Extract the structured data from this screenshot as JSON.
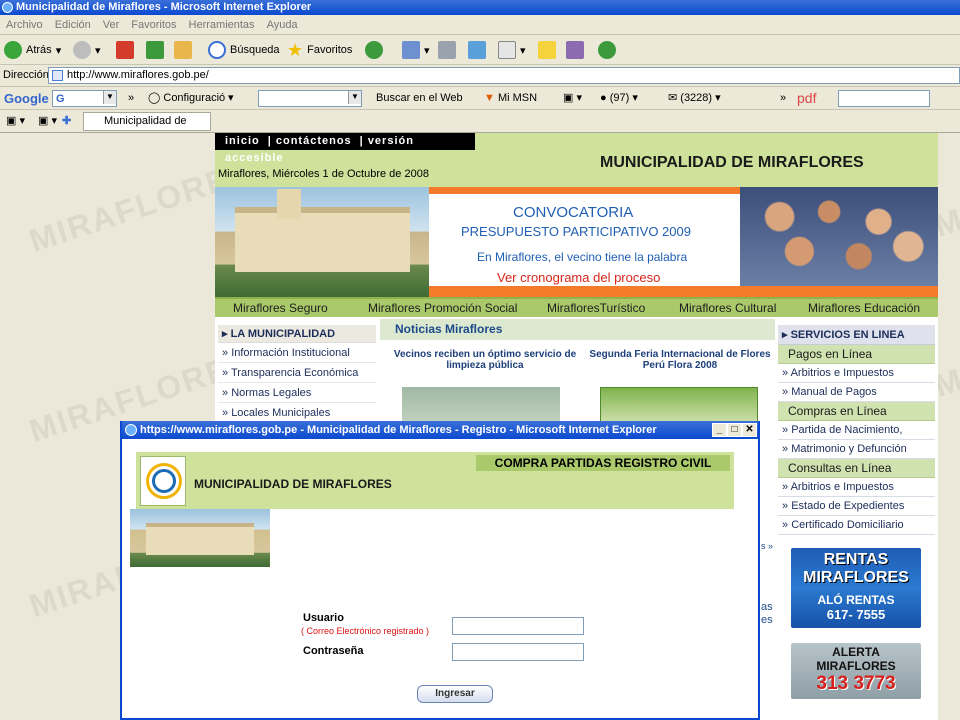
{
  "window": {
    "title": "Municipalidad de Miraflores - Microsoft Internet Explorer"
  },
  "menubar": {
    "items": [
      "Archivo",
      "Edición",
      "Ver",
      "Favoritos",
      "Herramientas",
      "Ayuda"
    ]
  },
  "toolbar": {
    "back_label": "Atrás",
    "search_label": "Búsqueda",
    "favorites_label": "Favoritos"
  },
  "address": {
    "label": "Dirección",
    "url": "http://www.miraflores.gob.pe/"
  },
  "googlebar": {
    "brand": "Google",
    "search_prefix": "G",
    "config_label": "Configuració",
    "search_web": "Buscar en el Web",
    "msn": "Mi MSN",
    "count1": "(97)",
    "count2": "(3228)",
    "pdf": "pdf"
  },
  "tabs": {
    "active": "Municipalidad de Mir..."
  },
  "watermark": "MIRAFLORES",
  "site": {
    "topnav": [
      "inicio",
      "contáctenos",
      "versión accesible"
    ],
    "date": "Miraflores, Miércoles 1 de Octubre de 2008",
    "name": "MUNICIPALIDAD DE MIRAFLORES",
    "banner": {
      "convocatoria": "CONVOCATORIA",
      "presupuesto": "PRESUPUESTO PARTICIPATIVO 2009",
      "vecino": "En Miraflores, el vecino tiene la palabra",
      "cronograma": "Ver cronograma del proceso"
    },
    "mainnav": [
      "Miraflores Seguro",
      "Miraflores Promoción Social",
      "MirafloresTurístico",
      "Miraflores Cultural",
      "Miraflores Educación"
    ],
    "leftmenu": {
      "header": "LA MUNICIPALIDAD",
      "items": [
        "Información Institucional",
        "Transparencia Económica",
        "Normas Legales",
        "Locales Municipales"
      ]
    },
    "news": {
      "header": "Noticias Miraflores",
      "item1": "Vecinos reciben un óptimo servicio de limpieza pública",
      "item2": "Segunda Feria Internacional de Flores Perú Flora 2008"
    },
    "rightmenu": {
      "header": "SERVICIOS EN LINEA",
      "pagos": "Pagos en Línea",
      "pagos_items": [
        "Arbitrios e Impuestos",
        "Manual de Pagos"
      ],
      "compras": "Compras en Línea",
      "compras_items": [
        "Partida de Nacimiento,",
        "Matrimonio y Defunción"
      ],
      "consultas": "Consultas en Línea",
      "consultas_items": [
        "Arbitrios e Impuestos",
        "Estado de Expedientes",
        "Certificado Domiciliario"
      ]
    },
    "ads": {
      "rentas1": "RENTAS",
      "rentas2": "MIRAFLORES",
      "alo": "ALÓ RENTAS",
      "phone": "617- 7555",
      "alerta1": "ALERTA",
      "alerta2": "MIRAFLORES",
      "alerta_phone": "313 3773"
    },
    "behind_fragments": [
      "s »",
      "as",
      "es"
    ]
  },
  "popup": {
    "title": "https://www.miraflores.gob.pe - Municipalidad de Miraflores - Registro - Microsoft Internet Explorer",
    "header_title": "COMPRA PARTIDAS REGISTRO CIVIL",
    "name": "MUNICIPALIDAD DE MIRAFLORES",
    "seal_text": "CIUDAD HEROICA",
    "usuario_label": "Usuario",
    "usuario_hint": "( Correo Electrónico registrado )",
    "password_label": "Contraseña",
    "usuario_value": "",
    "password_value": "",
    "submit_label": "Ingresar"
  }
}
